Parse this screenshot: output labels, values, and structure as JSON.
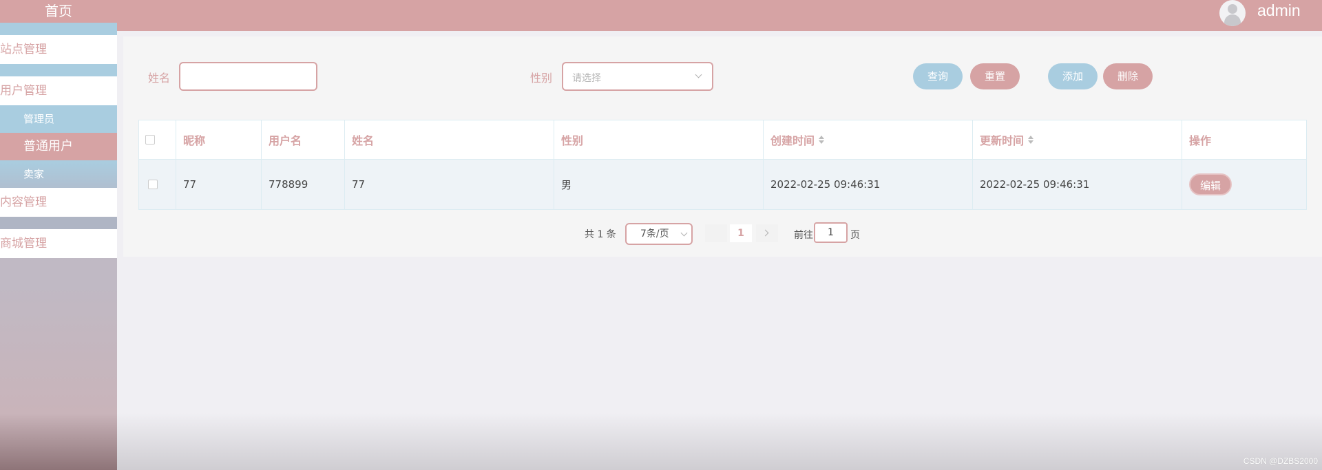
{
  "sidebar": {
    "home": "首页",
    "groups": {
      "site": "站点管理",
      "user": "用户管理",
      "content": "内容管理",
      "shop": "商城管理"
    },
    "user_sub": {
      "admin": "管理员",
      "normal": "普通用户",
      "seller": "卖家"
    }
  },
  "header": {
    "username": "admin"
  },
  "search": {
    "name_label": "姓名",
    "name_value": "",
    "gender_label": "性别",
    "gender_placeholder": "请选择",
    "query": "查询",
    "reset": "重置",
    "add": "添加",
    "delete": "删除"
  },
  "table": {
    "headers": [
      "昵称",
      "用户名",
      "姓名",
      "性别",
      "创建时间",
      "更新时间",
      "操作"
    ],
    "rows": [
      {
        "nickname": "77",
        "username": "778899",
        "name": "77",
        "gender": "男",
        "created": "2022-02-25 09:46:31",
        "updated": "2022-02-25 09:46:31",
        "action": "编辑"
      }
    ]
  },
  "pagination": {
    "total": "共 1 条",
    "page_size": "7条/页",
    "current_page": "1",
    "goto_prefix": "前往",
    "goto_value": "1",
    "goto_suffix": "页"
  },
  "watermark": "CSDN @DZBS2000",
  "colors": {
    "pink": "#d6a3a4",
    "blue": "#a9cde0"
  }
}
